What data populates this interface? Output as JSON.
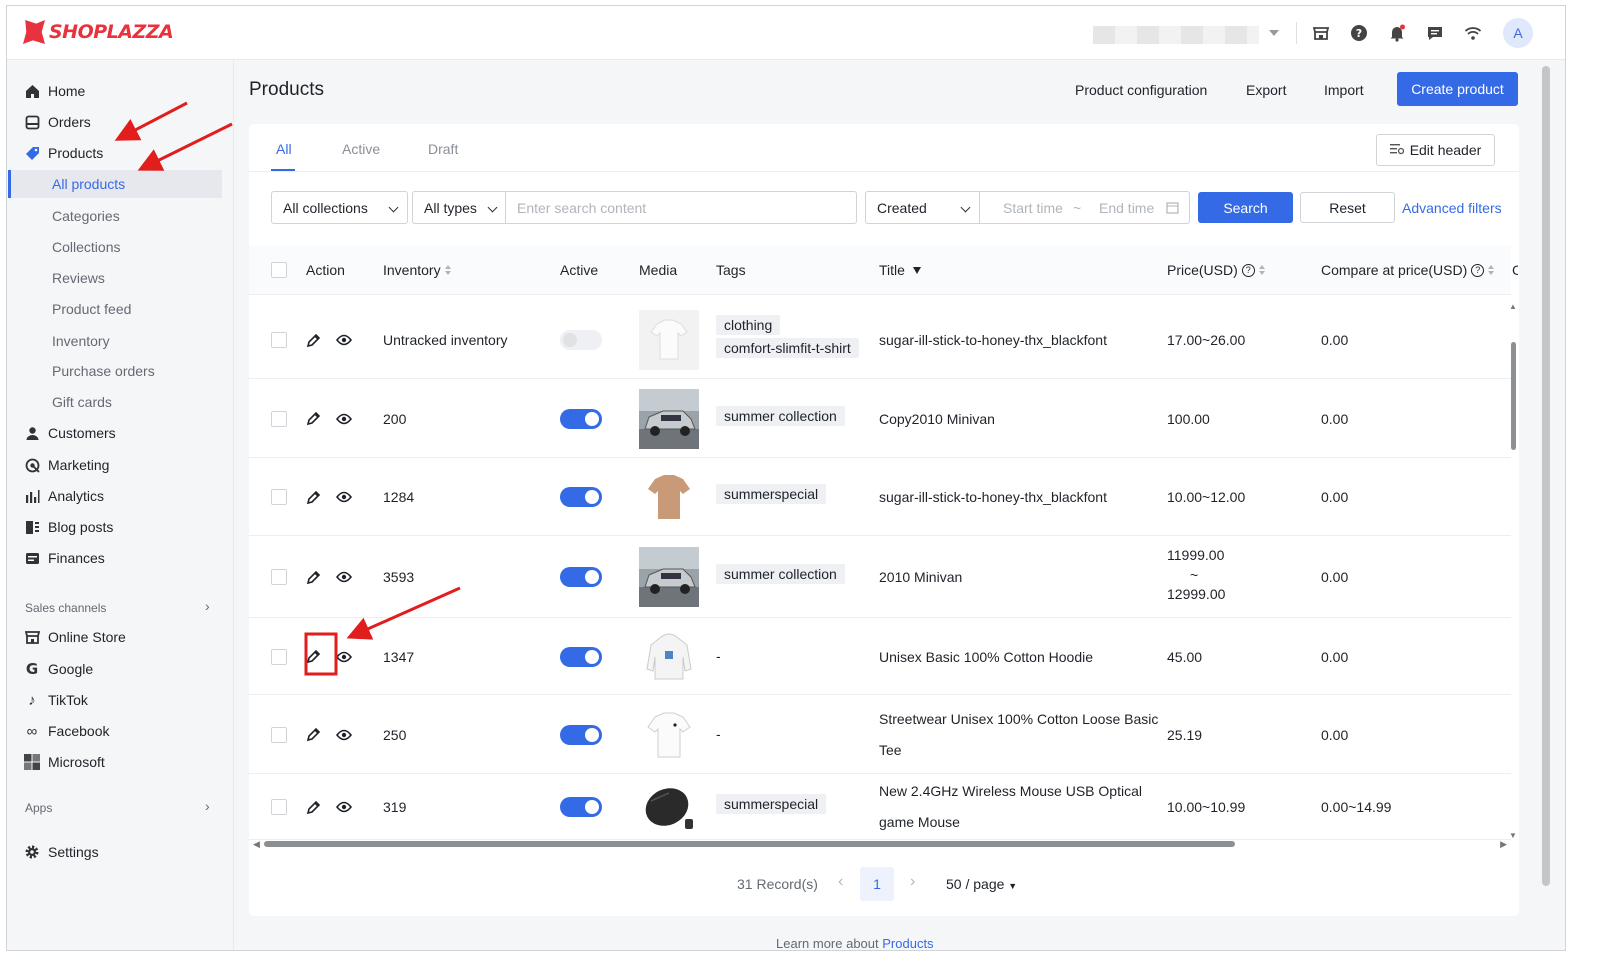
{
  "brand": {
    "name": "SHOPLAZZA",
    "accent": "#e8323e",
    "primary": "#356ae6"
  },
  "topbar": {
    "icons": [
      "store-icon",
      "help-icon",
      "bell-icon",
      "chat-icon",
      "wifi-icon"
    ],
    "avatar_initial": "A"
  },
  "sidebar": {
    "main": [
      {
        "label": "Home",
        "icon": "home-icon"
      },
      {
        "label": "Orders",
        "icon": "orders-icon"
      },
      {
        "label": "Products",
        "icon": "tag-icon"
      }
    ],
    "products_sub": [
      "All products",
      "Categories",
      "Collections",
      "Reviews",
      "Product feed",
      "Inventory",
      "Purchase orders",
      "Gift cards"
    ],
    "rest": [
      {
        "label": "Customers",
        "icon": "user-icon"
      },
      {
        "label": "Marketing",
        "icon": "marketing-icon"
      },
      {
        "label": "Analytics",
        "icon": "analytics-icon"
      },
      {
        "label": "Blog posts",
        "icon": "blog-icon"
      },
      {
        "label": "Finances",
        "icon": "finance-icon"
      }
    ],
    "sales_channels_label": "Sales channels",
    "channels": [
      {
        "label": "Online Store",
        "icon": "store-icon"
      },
      {
        "label": "Google",
        "icon": "google-icon"
      },
      {
        "label": "TikTok",
        "icon": "tiktok-icon"
      },
      {
        "label": "Facebook",
        "icon": "meta-icon"
      },
      {
        "label": "Microsoft",
        "icon": "microsoft-icon"
      }
    ],
    "apps_label": "Apps",
    "settings_label": "Settings"
  },
  "page": {
    "title": "Products",
    "actions": {
      "config": "Product configuration",
      "export": "Export",
      "import": "Import",
      "create": "Create product"
    },
    "tabs": [
      "All",
      "Active",
      "Draft"
    ],
    "edit_header": "Edit header"
  },
  "filters": {
    "collections": "All collections",
    "types": "All types",
    "search_placeholder": "Enter search content",
    "sort": "Created",
    "start_placeholder": "Start time",
    "range_sep": "~",
    "end_placeholder": "End time",
    "search_btn": "Search",
    "reset_btn": "Reset",
    "advanced": "Advanced filters"
  },
  "table": {
    "columns": {
      "action": "Action",
      "inventory": "Inventory",
      "active": "Active",
      "media": "Media",
      "tags": "Tags",
      "title": "Title",
      "price": "Price(USD)",
      "compare": "Compare at price(USD)",
      "cut": "C"
    },
    "rows": [
      {
        "inventory": "Untracked inventory",
        "active": false,
        "media": "white-tshirt",
        "tags": [
          "clothing",
          "comfort-slimfit-t-shirt"
        ],
        "title": "sugar-ill-stick-to-honey-thx_blackfont",
        "price": "17.00~26.00",
        "compare": "0.00"
      },
      {
        "inventory": "200",
        "active": true,
        "media": "silver-minivan",
        "tags": [
          "summer collection"
        ],
        "title": "Copy2010 Minivan",
        "price": "100.00",
        "compare": "0.00"
      },
      {
        "inventory": "1284",
        "active": true,
        "media": "tan-tshirt",
        "tags": [
          "summerspecial"
        ],
        "title": "sugar-ill-stick-to-honey-thx_blackfont",
        "price": "10.00~12.00",
        "compare": "0.00"
      },
      {
        "inventory": "3593",
        "active": true,
        "media": "silver-minivan",
        "tags": [
          "summer collection"
        ],
        "title": "2010 Minivan",
        "price_lines": [
          "11999.00",
          "~",
          "12999.00"
        ],
        "compare": "0.00"
      },
      {
        "inventory": "1347",
        "active": true,
        "media": "white-hoodie",
        "tags_text": "-",
        "title": "Unisex Basic 100% Cotton Hoodie",
        "price": "45.00",
        "compare": "0.00"
      },
      {
        "inventory": "250",
        "active": true,
        "media": "white-tee",
        "tags_text": "-",
        "title_lines": [
          "Streetwear Unisex 100% Cotton Loose Basic",
          "Tee"
        ],
        "price": "25.19",
        "compare": "0.00"
      },
      {
        "inventory": "319",
        "active": true,
        "media": "black-mouse",
        "tags": [
          "summerspecial"
        ],
        "title_lines": [
          "New 2.4GHz Wireless Mouse USB Optical",
          "game Mouse"
        ],
        "price": "10.00~10.99",
        "compare": "0.00~14.99"
      }
    ]
  },
  "pagination": {
    "records": "31 Record(s)",
    "current": "1",
    "per_page": "50 / page"
  },
  "footer": {
    "prefix": "Learn more about",
    "link": "Products"
  }
}
